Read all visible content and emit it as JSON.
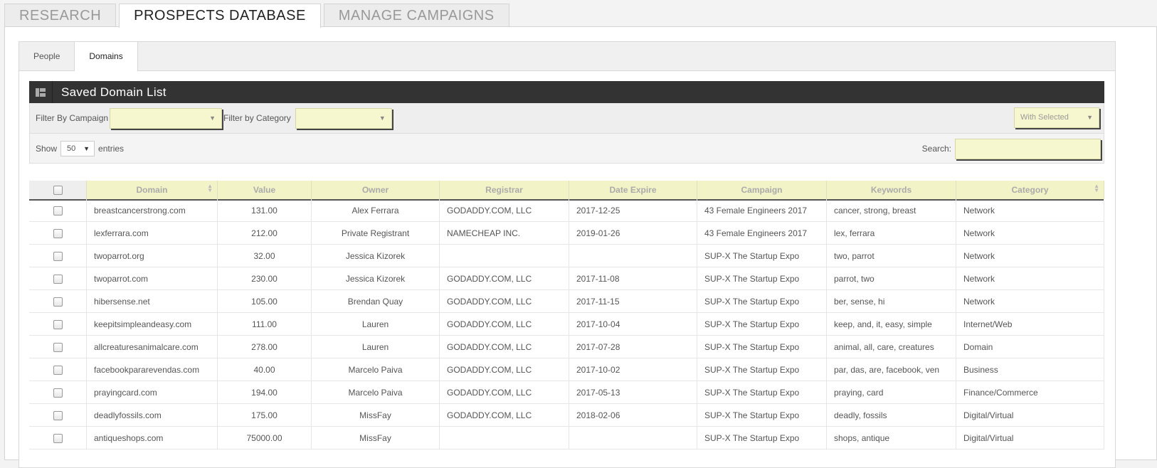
{
  "top_tabs": [
    "RESEARCH",
    "PROSPECTS DATABASE",
    "MANAGE CAMPAIGNS"
  ],
  "sub_tabs": [
    "People",
    "Domains"
  ],
  "widget": {
    "title": "Saved Domain List",
    "icon": "list-icon"
  },
  "filters": {
    "campaign_label": "Filter By Campaign",
    "category_label": "Filter by Category",
    "with_selected": "With Selected"
  },
  "length": {
    "show": "Show",
    "value": "50",
    "entries": "entries"
  },
  "search": {
    "label": "Search:",
    "value": ""
  },
  "table": {
    "columns": [
      "Domain",
      "Value",
      "Owner",
      "Registrar",
      "Date Expire",
      "Campaign",
      "Keywords",
      "Category"
    ],
    "rows": [
      [
        "breastcancerstrong.com",
        "131.00",
        "Alex Ferrara",
        "GODADDY.COM, LLC",
        "2017-12-25",
        "43 Female Engineers 2017",
        "cancer, strong, breast",
        "Network"
      ],
      [
        "lexferrara.com",
        "212.00",
        "Private Registrant",
        "NAMECHEAP INC.",
        "2019-01-26",
        "43 Female Engineers 2017",
        "lex, ferrara",
        "Network"
      ],
      [
        "twoparrot.org",
        "32.00",
        "Jessica Kizorek",
        "",
        "",
        "SUP-X The Startup Expo",
        "two, parrot",
        "Network"
      ],
      [
        "twoparrot.com",
        "230.00",
        "Jessica Kizorek",
        "GODADDY.COM, LLC",
        "2017-11-08",
        "SUP-X The Startup Expo",
        "parrot, two",
        "Network"
      ],
      [
        "hibersense.net",
        "105.00",
        "Brendan Quay",
        "GODADDY.COM, LLC",
        "2017-11-15",
        "SUP-X The Startup Expo",
        "ber, sense, hi",
        "Network"
      ],
      [
        "keepitsimpleandeasy.com",
        "111.00",
        "Lauren",
        "GODADDY.COM, LLC",
        "2017-10-04",
        "SUP-X The Startup Expo",
        "keep, and, it, easy, simple",
        "Internet/Web"
      ],
      [
        "allcreaturesanimalcare.com",
        "278.00",
        "Lauren",
        "GODADDY.COM, LLC",
        "2017-07-28",
        "SUP-X The Startup Expo",
        "animal, all, care, creatures",
        "Domain"
      ],
      [
        "facebookpararevendas.com",
        "40.00",
        "Marcelo Paiva",
        "GODADDY.COM, LLC",
        "2017-10-02",
        "SUP-X The Startup Expo",
        "par, das, are, facebook, ven",
        "Business"
      ],
      [
        "prayingcard.com",
        "194.00",
        "Marcelo Paiva",
        "GODADDY.COM, LLC",
        "2017-05-13",
        "SUP-X The Startup Expo",
        "praying, card",
        "Finance/Commerce"
      ],
      [
        "deadlyfossils.com",
        "175.00",
        "MissFay",
        "GODADDY.COM, LLC",
        "2018-02-06",
        "SUP-X The Startup Expo",
        "deadly, fossils",
        "Digital/Virtual"
      ],
      [
        "antiqueshops.com",
        "75000.00",
        "MissFay",
        "",
        "",
        "SUP-X The Startup Expo",
        "shops, antique",
        "Digital/Virtual"
      ]
    ]
  }
}
